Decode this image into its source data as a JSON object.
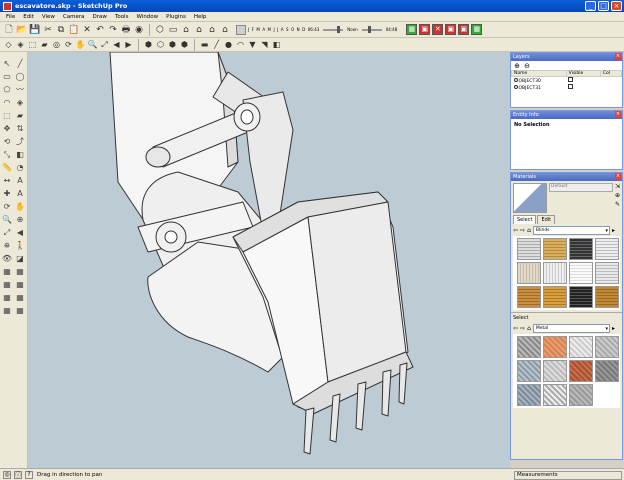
{
  "window": {
    "title": "escavatore.skp - SketchUp Pro"
  },
  "menu": [
    "File",
    "Edit",
    "View",
    "Camera",
    "Draw",
    "Tools",
    "Window",
    "Plugins",
    "Help"
  ],
  "shadow": {
    "months": "J F M A M J J A S O N D",
    "time_start": "06:43",
    "time_label": "Noon",
    "time_end": "04:48"
  },
  "layers": {
    "title": "Layers",
    "columns": [
      "Name",
      "Visible",
      "Col"
    ],
    "rows": [
      {
        "name": "OBJECT30"
      },
      {
        "name": "OBJECT31"
      }
    ]
  },
  "entity": {
    "title": "Entity Info",
    "status": "No Selection"
  },
  "materials": {
    "title": "Materials",
    "current_name": "Default",
    "tabs": [
      "Select",
      "Edit"
    ],
    "library1": "Blinds",
    "select_label": "Select",
    "library2": "Metal"
  },
  "status": {
    "message": "Drag in direction to pan",
    "measurements": "Measurements"
  },
  "colors": {
    "title_blue": "#0a5fd8",
    "viewport_bg": "#bdccd4",
    "panel_header": "#5a7ac8"
  }
}
